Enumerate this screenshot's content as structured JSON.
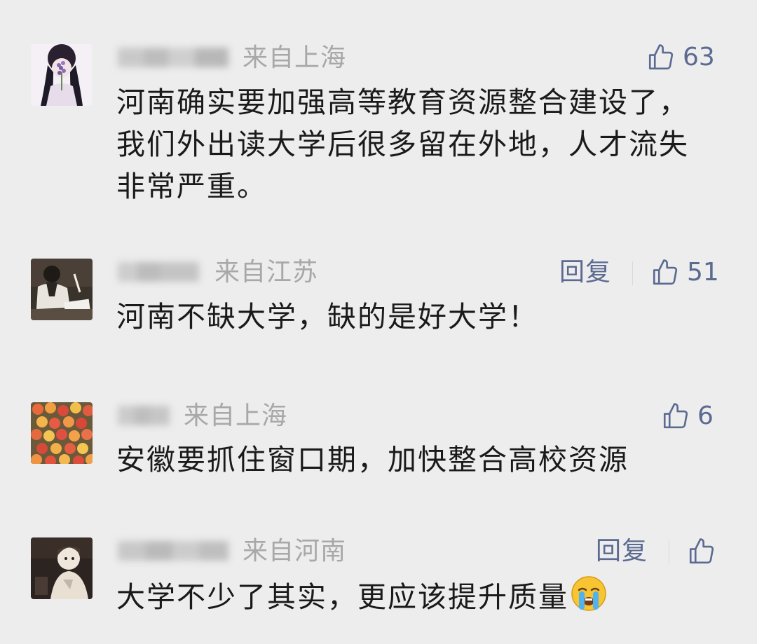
{
  "comments": [
    {
      "location": "来自上海",
      "likes": "63",
      "reply": "",
      "content": "河南确实要加强高等教育资源整合建设了，我们外出读大学后很多留在外地，人才流失非常严重。",
      "avatar": "avatar-girl-lavender"
    },
    {
      "location": "来自江苏",
      "likes": "51",
      "reply": "回复",
      "content": "河南不缺大学，缺的是好大学！",
      "avatar": "avatar-student-desk"
    },
    {
      "location": "来自上海",
      "likes": "6",
      "reply": "",
      "content": "安徽要抓住窗口期，加快整合高校资源",
      "avatar": "avatar-flowers"
    },
    {
      "location": "来自河南",
      "likes": "",
      "reply": "回复",
      "content": "大学不少了其实，更应该提升质量",
      "avatar": "avatar-illustrated-boy",
      "emoji": "crying-face-emoji"
    }
  ],
  "colors": {
    "background": "#ededed",
    "link": "#5b6a91",
    "meta": "#a8a8a8",
    "text": "#1a1a1a"
  }
}
